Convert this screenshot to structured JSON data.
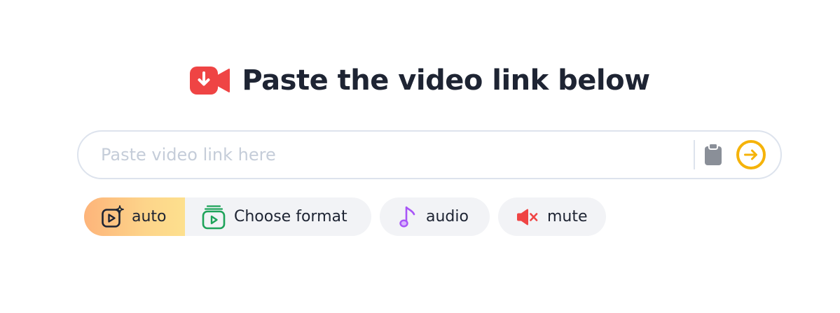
{
  "heading": {
    "title": "Paste the video link below",
    "icon": "video-download-icon",
    "icon_color": "#ef4444"
  },
  "search": {
    "value": "",
    "placeholder": "Paste video link here",
    "paste_icon": "clipboard-icon",
    "submit_icon": "arrow-right-circle-icon",
    "accent_color": "#f5b30a"
  },
  "options": {
    "auto": {
      "label": "auto",
      "icon": "sparkle-play-icon",
      "selected": true
    },
    "format": {
      "label": "Choose format",
      "icon": "video-stack-icon",
      "icon_color": "#1ea35a"
    },
    "audio": {
      "label": "audio",
      "icon": "music-note-icon",
      "icon_color": "#a855f7"
    },
    "mute": {
      "label": "mute",
      "icon": "speaker-mute-icon",
      "icon_color": "#ef4444"
    }
  }
}
